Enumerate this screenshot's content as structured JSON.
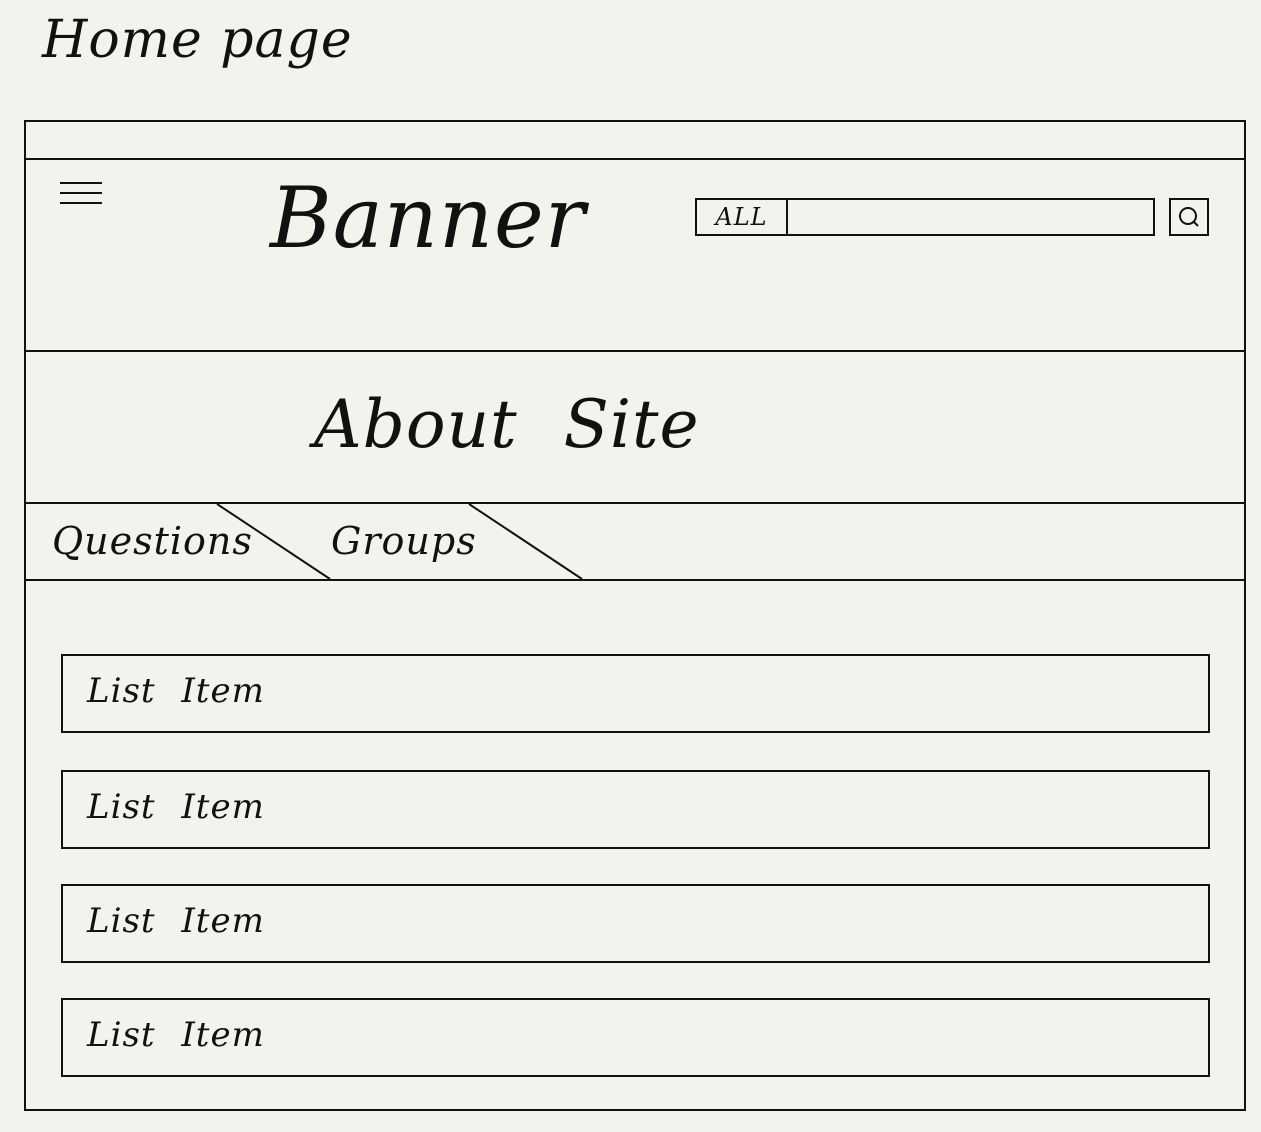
{
  "page_title": "Home page",
  "header": {
    "banner": "Banner",
    "search": {
      "scope": "ALL",
      "placeholder": "",
      "icon": "search-icon"
    },
    "menu_icon": "hamburger-menu-icon"
  },
  "about": {
    "text": "About Site"
  },
  "tabs": [
    {
      "label": "Questions"
    },
    {
      "label": "Groups"
    }
  ],
  "list": {
    "items": [
      {
        "label": "List Item"
      },
      {
        "label": "List Item"
      },
      {
        "label": "List Item"
      },
      {
        "label": "List Item"
      }
    ]
  }
}
